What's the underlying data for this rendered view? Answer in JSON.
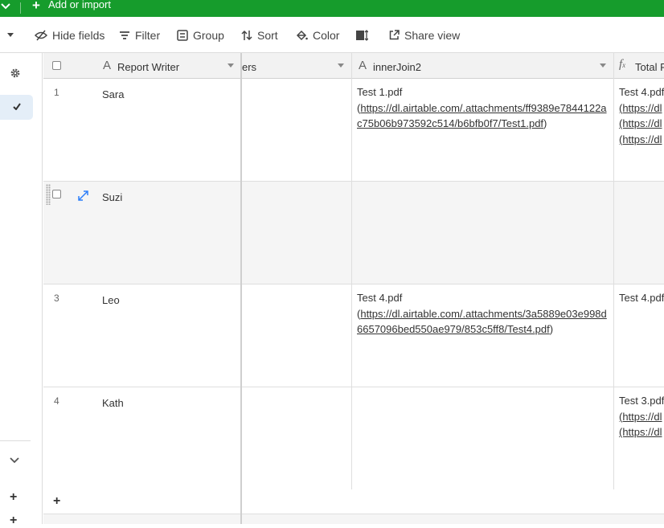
{
  "topbar": {
    "add_label": "Add or import",
    "color": "#169c2c"
  },
  "toolbar": {
    "hide_fields": "Hide fields",
    "filter": "Filter",
    "group": "Group",
    "sort": "Sort",
    "color": "Color",
    "share_view": "Share view"
  },
  "columns": {
    "report_writer": "Report Writer",
    "col2_partial": "ers",
    "inner_join": "innerJoin2",
    "total_partial": "Total P"
  },
  "rows": [
    {
      "num": "1",
      "writer": "Sara",
      "inner_file": " Test 1.pdf",
      "inner_url": "https://dl.airtable.com/.attachments/ff9389e7844122ac75b06b973592c514/b6bfb0f7/Test1.pdf",
      "total_lines": [
        "Test 4.pdf",
        "(https://dl",
        "(https://dl",
        "(https://dl"
      ]
    },
    {
      "num": "",
      "writer": "Suzi",
      "inner_file": "",
      "inner_url": "",
      "total_lines": []
    },
    {
      "num": "3",
      "writer": "Leo",
      "inner_file": "Test 4.pdf",
      "inner_url": "https://dl.airtable.com/.attachments/3a5889e03e998d6657096bed550ae979/853c5ff8/Test4.pdf",
      "total_lines": [
        "Test 4.pdf"
      ]
    },
    {
      "num": "4",
      "writer": "Kath",
      "inner_file": "",
      "inner_url": "",
      "total_lines": [
        "Test 3.pdf",
        "(https://dl",
        "(https://dl"
      ]
    }
  ]
}
